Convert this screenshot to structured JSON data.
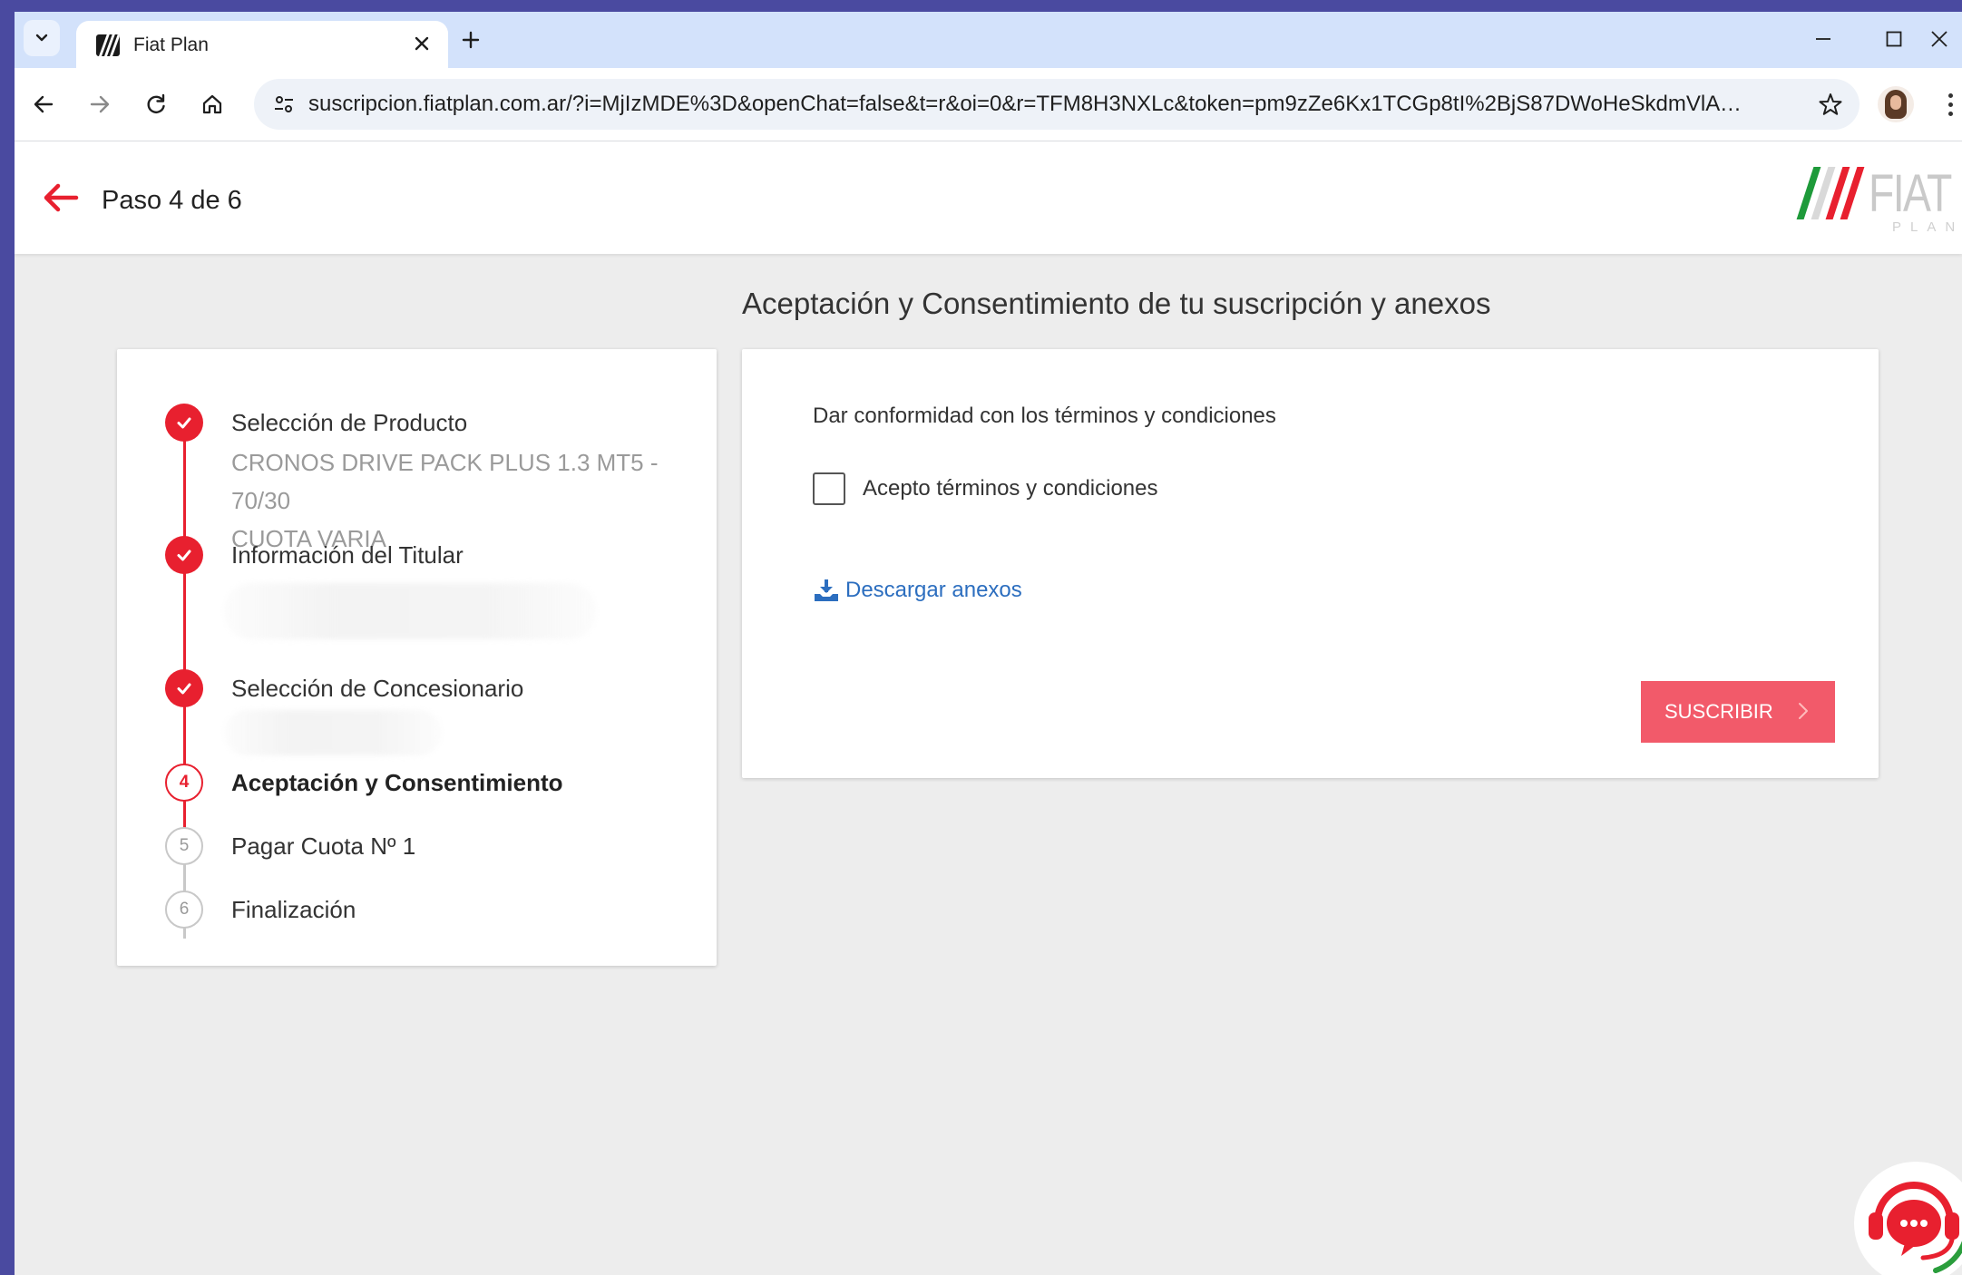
{
  "browser": {
    "tab_title": "Fiat Plan",
    "url": "suscripcion.fiatplan.com.ar/?i=MjIzMDE%3D&openChat=false&t=r&oi=0&r=TFM8H3NXLc&token=pm9zZe6Kx1TCGp8tI%2BjS87DWoHeSkdmVlAwYZ...",
    "icons": [
      "chevron-down-icon",
      "close-icon",
      "plus-icon",
      "minimize-icon",
      "maximize-icon",
      "back-icon",
      "forward-icon",
      "reload-icon",
      "home-icon",
      "tune-icon",
      "star-icon",
      "kebab-menu-icon"
    ]
  },
  "header": {
    "step_text": "Paso 4 de 6",
    "brand_word": "FIAT",
    "brand_sub": "PLAN"
  },
  "section_title": "Aceptación y Consentimiento de tu suscripción y anexos",
  "stepper": {
    "steps": [
      {
        "number": "1",
        "label": "Selección de Producto",
        "status": "done",
        "detail_lines": [
          "CRONOS DRIVE PACK PLUS 1.3 MT5 - 70/30",
          "CUOTA VARIA"
        ]
      },
      {
        "number": "2",
        "label": "Información del Titular",
        "status": "done"
      },
      {
        "number": "3",
        "label": "Selección de Concesionario",
        "status": "done"
      },
      {
        "number": "4",
        "label": "Aceptación y Consentimiento",
        "status": "active"
      },
      {
        "number": "5",
        "label": "Pagar Cuota Nº 1",
        "status": "pending"
      },
      {
        "number": "6",
        "label": "Finalización",
        "status": "pending"
      }
    ]
  },
  "terms": {
    "heading": "Dar conformidad con los términos y condiciones",
    "checkbox_label": "Acepto términos y condiciones",
    "checkbox_checked": false,
    "download_label": "Descargar anexos",
    "submit_label": "SUSCRIBIR"
  },
  "colors": {
    "accent_red": "#e8202f",
    "submit_bg": "#f25a6a",
    "link_blue": "#2c6ebf",
    "page_bg": "#ededed"
  }
}
